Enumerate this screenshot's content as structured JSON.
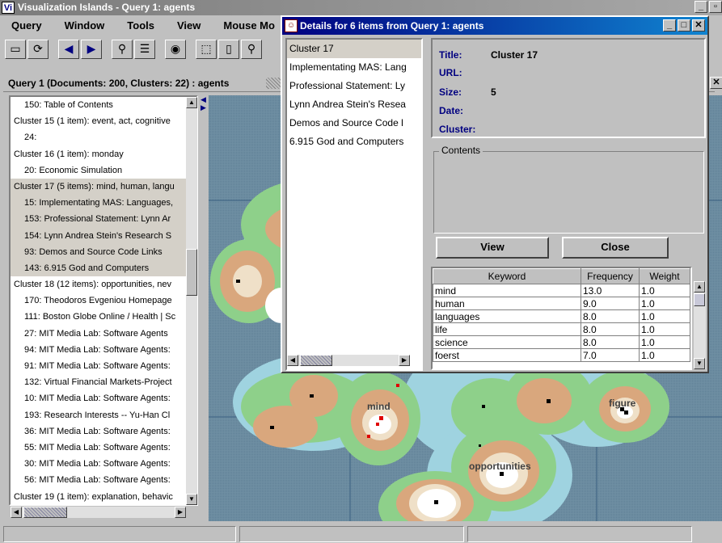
{
  "app": {
    "title": "Visualization Islands  -  Query 1:  agents",
    "icon_text": "Vi"
  },
  "menu": [
    "Query",
    "Window",
    "Tools",
    "View",
    "Mouse Mo"
  ],
  "query_header": "Query 1  (Documents: 200,  Clusters: 22) :  agents",
  "result_list": [
    {
      "text": "150: Table of Contents",
      "indent": true,
      "sel": false
    },
    {
      "text": "Cluster 15 (1 item): event, act, cognitive",
      "indent": false,
      "sel": false
    },
    {
      "text": "24:",
      "indent": true,
      "sel": false
    },
    {
      "text": "Cluster 16 (1 item): monday",
      "indent": false,
      "sel": false
    },
    {
      "text": "20: Economic Simulation",
      "indent": true,
      "sel": false
    },
    {
      "text": "Cluster 17 (5 items): mind, human, langu",
      "indent": false,
      "sel": true
    },
    {
      "text": "15: Implementating MAS: Languages,",
      "indent": true,
      "sel": true
    },
    {
      "text": "153: Professional Statement: Lynn Ar",
      "indent": true,
      "sel": true
    },
    {
      "text": "154: Lynn Andrea Stein's Research S",
      "indent": true,
      "sel": true
    },
    {
      "text": "93: Demos and Source Code Links",
      "indent": true,
      "sel": true
    },
    {
      "text": "143: 6.915 God and Computers",
      "indent": true,
      "sel": true
    },
    {
      "text": "Cluster 18 (12 items): opportunities, nev",
      "indent": false,
      "sel": false
    },
    {
      "text": "170: Theodoros Evgeniou Homepage",
      "indent": true,
      "sel": false
    },
    {
      "text": "111: Boston Globe Online / Health | Sc",
      "indent": true,
      "sel": false
    },
    {
      "text": "27: MIT Media Lab: Software Agents",
      "indent": true,
      "sel": false
    },
    {
      "text": "94: MIT Media Lab: Software Agents:",
      "indent": true,
      "sel": false
    },
    {
      "text": "91: MIT Media Lab: Software Agents:",
      "indent": true,
      "sel": false
    },
    {
      "text": "132: Virtual Financial Markets-Project",
      "indent": true,
      "sel": false
    },
    {
      "text": "10: MIT Media Lab: Software Agents:",
      "indent": true,
      "sel": false
    },
    {
      "text": "193: Research Interests -- Yu-Han Cl",
      "indent": true,
      "sel": false
    },
    {
      "text": "36: MIT Media Lab: Software Agents:",
      "indent": true,
      "sel": false
    },
    {
      "text": "55: MIT Media Lab: Software Agents:",
      "indent": true,
      "sel": false
    },
    {
      "text": "30: MIT Media Lab: Software Agents:",
      "indent": true,
      "sel": false
    },
    {
      "text": "56: MIT Media Lab: Software Agents:",
      "indent": true,
      "sel": false
    },
    {
      "text": "Cluster 19 (1 item): explanation, behavic",
      "indent": false,
      "sel": false
    }
  ],
  "map_labels": [
    "mind",
    "figure",
    "opportunities"
  ],
  "dialog": {
    "title": "Details for 6 items from  Query 1:  agents",
    "items": [
      "Cluster 17",
      "Implementating MAS: Lang",
      "Professional Statement: Ly",
      "Lynn Andrea Stein's Resea",
      "Demos and Source Code l",
      "6.915 God and Computers"
    ],
    "fields": {
      "title_label": "Title:",
      "title_value": "Cluster 17",
      "url_label": "URL:",
      "url_value": "",
      "size_label": "Size:",
      "size_value": "5",
      "date_label": "Date:",
      "date_value": "",
      "cluster_label": "Cluster:",
      "cluster_value": ""
    },
    "contents_label": "Contents",
    "view_label": "View",
    "close_label": "Close",
    "keyword_headers": [
      "Keyword",
      "Frequency",
      "Weight"
    ],
    "keywords": [
      [
        "mind",
        "13.0",
        "1.0"
      ],
      [
        "human",
        "9.0",
        "1.0"
      ],
      [
        "languages",
        "8.0",
        "1.0"
      ],
      [
        "life",
        "8.0",
        "1.0"
      ],
      [
        "science",
        "8.0",
        "1.0"
      ],
      [
        "foerst",
        "7.0",
        "1.0"
      ]
    ]
  },
  "colors": {
    "dialog_title": "#000080",
    "info_label": "#000080",
    "map_sea": "#6f8fa3",
    "island_green": "#8ed08a",
    "island_tan": "#d9a77d",
    "island_light": "#efe0c8"
  }
}
